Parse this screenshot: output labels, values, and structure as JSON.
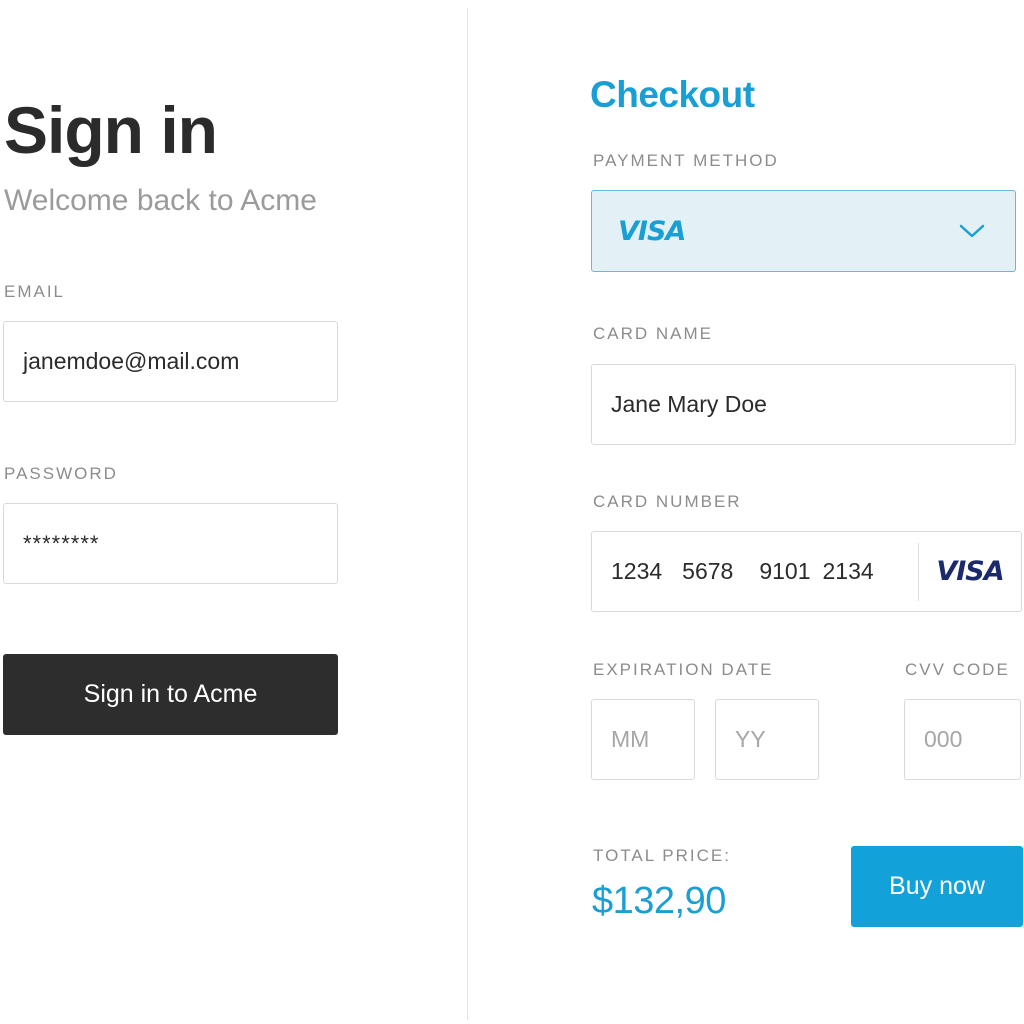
{
  "signin": {
    "title": "Sign in",
    "subtitle": "Welcome back to Acme",
    "email_label": "EMAIL",
    "email_value": "janemdoe@mail.com",
    "password_label": "PASSWORD",
    "password_value": "********",
    "submit_label": "Sign in to Acme"
  },
  "checkout": {
    "title": "Checkout",
    "payment_method_label": "PAYMENT METHOD",
    "payment_method_value": "VISA",
    "card_name_label": "CARD NAME",
    "card_name_value": "Jane Mary Doe",
    "card_number_label": "CARD NUMBER",
    "card_number_groups": [
      "1234",
      "5678",
      "9101",
      "2134"
    ],
    "card_brand": "VISA",
    "expiration_label": "EXPIRATION DATE",
    "month_placeholder": "MM",
    "year_placeholder": "YY",
    "cvv_label": "CVV CODE",
    "cvv_placeholder": "000",
    "total_label": "TOTAL PRICE:",
    "total_value": "$132,90",
    "buy_label": "Buy now"
  },
  "icons": {
    "select_chevron": "chevron-down-icon"
  },
  "colors": {
    "accent": "#1a9fd4",
    "buy_button": "#12a2d9",
    "signin_button": "#2d2d2d",
    "select_background": "#e3f1f7",
    "visa_brand": "#1a2a6c"
  }
}
